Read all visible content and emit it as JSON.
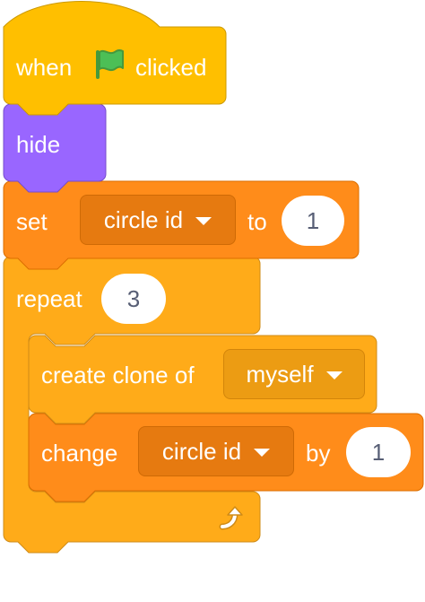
{
  "script": {
    "hat": {
      "when_label": "when",
      "flag_icon": "green-flag-icon",
      "clicked_label": "clicked"
    },
    "hide": {
      "label": "hide"
    },
    "set_var": {
      "set_label": "set",
      "variable": "circle id",
      "to_label": "to",
      "value": "1"
    },
    "repeat": {
      "label": "repeat",
      "count": "3",
      "loop_icon": "loop-arrow-icon"
    },
    "create_clone": {
      "label": "create clone of",
      "target": "myself"
    },
    "change_var": {
      "change_label": "change",
      "variable": "circle id",
      "by_label": "by",
      "value": "1"
    }
  },
  "colors": {
    "events": "#ffbf00",
    "events_border": "#cc9900",
    "looks": "#9966ff",
    "looks_border": "#774dcb",
    "control": "#ffab19",
    "control_border": "#cf8b17",
    "variables": "#ff8c1a",
    "variables_border": "#db6e00",
    "control_dropdown": "#ec9c13",
    "variables_dropdown": "#e67a10",
    "number_text": "#575e75",
    "flag_green": "#4cbf56",
    "flag_dark": "#45993d"
  }
}
